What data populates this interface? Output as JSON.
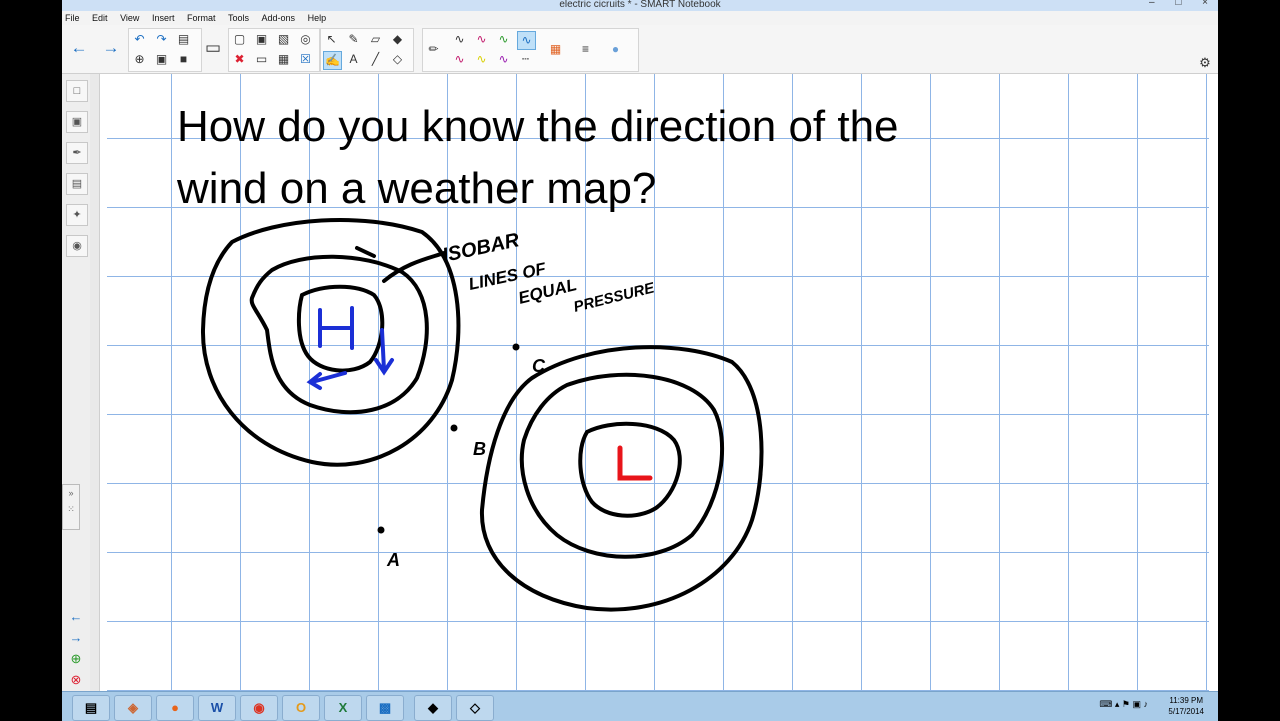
{
  "window": {
    "title": "electric cicruits * - SMART Notebook",
    "controls": [
      "–",
      "□",
      "×"
    ]
  },
  "menu": [
    "File",
    "Edit",
    "View",
    "Insert",
    "Format",
    "Tools",
    "Add-ons",
    "Help"
  ],
  "page": {
    "heading_line1": "How do you know the direction of the",
    "heading_line2": "wind on a weather map?"
  },
  "annotations": {
    "isobar": "ISOBAR",
    "lines_of": "LINES OF",
    "equal": "EQUAL",
    "pressure": "PRESSURE",
    "high": "H",
    "low": "L",
    "point_a": "A",
    "point_b": "B",
    "point_c": "C"
  },
  "colors": {
    "high_marker": "#1b2fd6",
    "low_marker": "#e8141a",
    "ink": "#000000",
    "grid": "#8fb5e6"
  },
  "taskbar": {
    "apps": [
      "explorer-icon",
      "app-icon",
      "firefox-icon",
      "word-icon",
      "chrome-icon",
      "outlook-icon",
      "excel-icon",
      "notebook-icon",
      "smart-icon",
      "tool-icon"
    ],
    "time": "11:39 PM",
    "date": "5/17/2014"
  }
}
